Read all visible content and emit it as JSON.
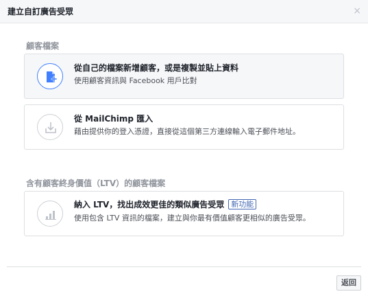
{
  "dialog": {
    "title": "建立自訂廣告受眾",
    "close_glyph": "×"
  },
  "sections": {
    "customer_file_label": "顧客檔案",
    "ltv_label": "含有顧客終身價值（LTV）的顧客檔案"
  },
  "options": [
    {
      "title": "從自己的檔案新增顧客，或是複製並貼上資料",
      "description": "使用顧客資訊與 Facebook 用戶比對",
      "icon": "file-add-icon",
      "selected": true
    },
    {
      "title": "從 MailChimp 匯入",
      "description": "藉由提供你的登入憑證，直接從這個第三方連線輸入電子郵件地址。",
      "icon": "import-icon",
      "selected": false
    },
    {
      "title": "納入 LTV，找出成效更佳的類似廣告受眾",
      "badge": "新功能",
      "description": "使用包含 LTV 資訊的檔案，建立與你最有價值顧客更相似的廣告受眾。",
      "icon": "bar-chart-icon",
      "selected": false
    }
  ],
  "footer": {
    "back_label": "返回"
  },
  "colors": {
    "accent": "#4080ff",
    "badge": "#4267b2",
    "muted": "#90949c"
  }
}
